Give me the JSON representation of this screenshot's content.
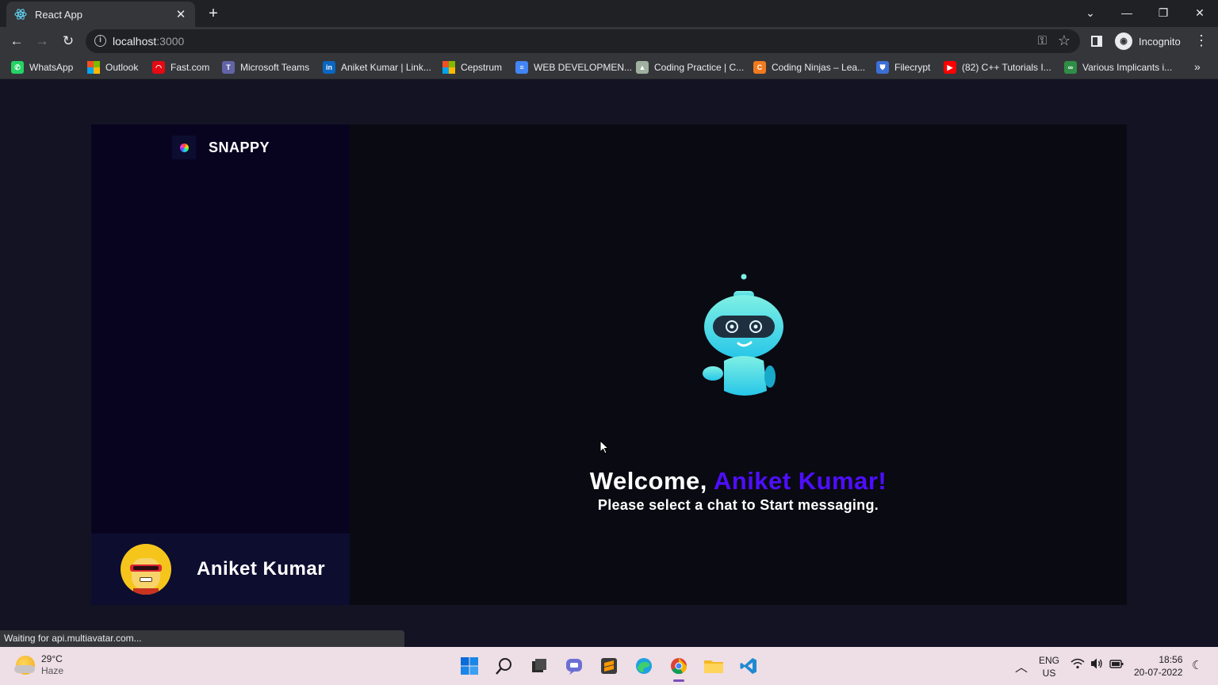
{
  "browser": {
    "tab": {
      "title": "React App"
    },
    "url": {
      "host": "localhost",
      "port": ":3000"
    },
    "profile_label": "Incognito",
    "bookmarks": [
      {
        "label": "WhatsApp",
        "icon": "whatsapp-icon",
        "color": "#25d366"
      },
      {
        "label": "Outlook",
        "icon": "microsoft-icon",
        "color": "#f25022"
      },
      {
        "label": "Fast.com",
        "icon": "fast-icon",
        "color": "#e50914"
      },
      {
        "label": "Microsoft Teams",
        "icon": "teams-icon",
        "color": "#6264a7"
      },
      {
        "label": "Aniket Kumar | Link...",
        "icon": "linkedin-icon",
        "color": "#0a66c2"
      },
      {
        "label": "Cepstrum",
        "icon": "microsoft-icon",
        "color": "#f25022"
      },
      {
        "label": "WEB DEVELOPMEN...",
        "icon": "docs-icon",
        "color": "#4285f4"
      },
      {
        "label": "Coding Practice | C...",
        "icon": "mountain-icon",
        "color": "#9fb0a0"
      },
      {
        "label": "Coding Ninjas – Lea...",
        "icon": "codingninjas-icon",
        "color": "#f07b1e"
      },
      {
        "label": "Filecrypt",
        "icon": "shield-icon",
        "color": "#3b6fd6"
      },
      {
        "label": "(82) C++ Tutorials I...",
        "icon": "youtube-icon",
        "color": "#ff0000"
      },
      {
        "label": "Various Implicants i...",
        "icon": "gfg-icon",
        "color": "#2f8d46"
      }
    ],
    "status_text": "Waiting for api.multiavatar.com..."
  },
  "app": {
    "brand": "SNAPPY",
    "current_user": "Aniket Kumar",
    "welcome": {
      "greeting": "Welcome,",
      "username": "Aniket Kumar!",
      "subtitle": "Please select a chat to Start messaging."
    },
    "colors": {
      "accent": "#4e0eff",
      "background": "#131324",
      "sidebar": "#080420"
    }
  },
  "taskbar": {
    "weather_temp": "29°C",
    "weather_cond": "Haze",
    "lang_primary": "ENG",
    "lang_secondary": "US",
    "time": "18:56",
    "date": "20-07-2022"
  }
}
